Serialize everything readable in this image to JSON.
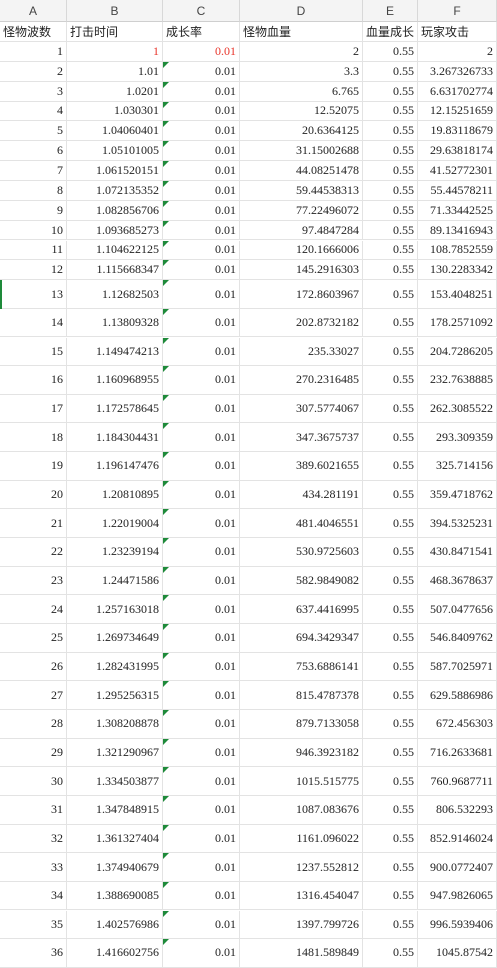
{
  "spreadsheet": {
    "column_letters": [
      "A",
      "B",
      "C",
      "D",
      "E",
      "F"
    ],
    "headers": [
      "怪物波数",
      "打击时间",
      "成长率",
      "怪物血量",
      "血量成长",
      "玩家攻击"
    ],
    "rows": [
      [
        "1",
        "1",
        "0.01",
        "2",
        "0.55",
        "2"
      ],
      [
        "2",
        "1.01",
        "0.01",
        "3.3",
        "0.55",
        "3.267326733"
      ],
      [
        "3",
        "1.0201",
        "0.01",
        "6.765",
        "0.55",
        "6.631702774"
      ],
      [
        "4",
        "1.030301",
        "0.01",
        "12.52075",
        "0.55",
        "12.15251659"
      ],
      [
        "5",
        "1.04060401",
        "0.01",
        "20.6364125",
        "0.55",
        "19.83118679"
      ],
      [
        "6",
        "1.05101005",
        "0.01",
        "31.15002688",
        "0.55",
        "29.63818174"
      ],
      [
        "7",
        "1.061520151",
        "0.01",
        "44.08251478",
        "0.55",
        "41.52772301"
      ],
      [
        "8",
        "1.072135352",
        "0.01",
        "59.44538313",
        "0.55",
        "55.44578211"
      ],
      [
        "9",
        "1.082856706",
        "0.01",
        "77.22496072",
        "0.55",
        "71.33442525"
      ],
      [
        "10",
        "1.093685273",
        "0.01",
        "97.4847284",
        "0.55",
        "89.13416943"
      ],
      [
        "11",
        "1.104622125",
        "0.01",
        "120.1666006",
        "0.55",
        "108.7852559"
      ],
      [
        "12",
        "1.115668347",
        "0.01",
        "145.2916303",
        "0.55",
        "130.2283342"
      ],
      [
        "13",
        "1.12682503",
        "0.01",
        "172.8603967",
        "0.55",
        "153.4048251"
      ],
      [
        "14",
        "1.13809328",
        "0.01",
        "202.8732182",
        "0.55",
        "178.2571092"
      ],
      [
        "15",
        "1.149474213",
        "0.01",
        "235.33027",
        "0.55",
        "204.7286205"
      ],
      [
        "16",
        "1.160968955",
        "0.01",
        "270.2316485",
        "0.55",
        "232.7638885"
      ],
      [
        "17",
        "1.172578645",
        "0.01",
        "307.5774067",
        "0.55",
        "262.3085522"
      ],
      [
        "18",
        "1.184304431",
        "0.01",
        "347.3675737",
        "0.55",
        "293.309359"
      ],
      [
        "19",
        "1.196147476",
        "0.01",
        "389.6021655",
        "0.55",
        "325.714156"
      ],
      [
        "20",
        "1.20810895",
        "0.01",
        "434.281191",
        "0.55",
        "359.4718762"
      ],
      [
        "21",
        "1.22019004",
        "0.01",
        "481.4046551",
        "0.55",
        "394.5325231"
      ],
      [
        "22",
        "1.23239194",
        "0.01",
        "530.9725603",
        "0.55",
        "430.8471541"
      ],
      [
        "23",
        "1.24471586",
        "0.01",
        "582.9849082",
        "0.55",
        "468.3678637"
      ],
      [
        "24",
        "1.257163018",
        "0.01",
        "637.4416995",
        "0.55",
        "507.0477656"
      ],
      [
        "25",
        "1.269734649",
        "0.01",
        "694.3429347",
        "0.55",
        "546.8409762"
      ],
      [
        "26",
        "1.282431995",
        "0.01",
        "753.6886141",
        "0.55",
        "587.7025971"
      ],
      [
        "27",
        "1.295256315",
        "0.01",
        "815.4787378",
        "0.55",
        "629.5886986"
      ],
      [
        "28",
        "1.308208878",
        "0.01",
        "879.7133058",
        "0.55",
        "672.456303"
      ],
      [
        "29",
        "1.321290967",
        "0.01",
        "946.3923182",
        "0.55",
        "716.2633681"
      ],
      [
        "30",
        "1.334503877",
        "0.01",
        "1015.515775",
        "0.55",
        "760.9687711"
      ],
      [
        "31",
        "1.347848915",
        "0.01",
        "1087.083676",
        "0.55",
        "806.532293"
      ],
      [
        "32",
        "1.361327404",
        "0.01",
        "1161.096022",
        "0.55",
        "852.9146024"
      ],
      [
        "33",
        "1.374940679",
        "0.01",
        "1237.552812",
        "0.55",
        "900.0772407"
      ],
      [
        "34",
        "1.388690085",
        "0.01",
        "1316.454047",
        "0.55",
        "947.9826065"
      ],
      [
        "35",
        "1.402576986",
        "0.01",
        "1397.799726",
        "0.55",
        "996.5939406"
      ],
      [
        "36",
        "1.416602756",
        "0.01",
        "1481.589849",
        "0.55",
        "1045.87542"
      ]
    ],
    "red_text_color": "#e8342a",
    "flag_color": "#1e8a3a",
    "header_bg": "#f4f4f4"
  }
}
